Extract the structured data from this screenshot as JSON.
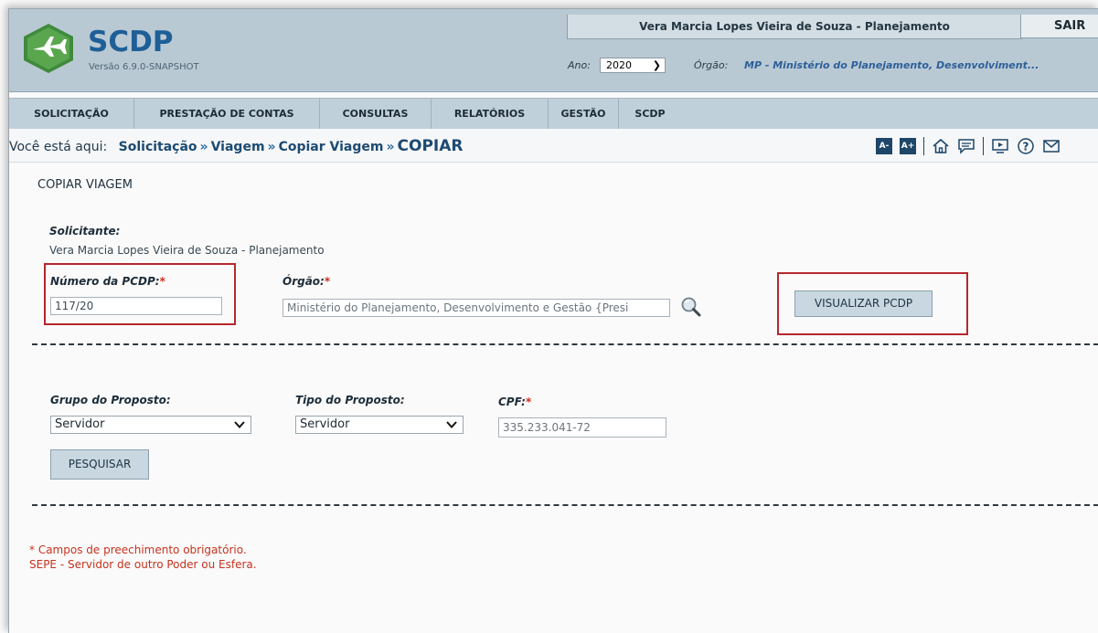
{
  "header": {
    "app_name": "SCDP",
    "version": "Versão 6.9.0-SNAPSHOT",
    "user": "Vera Marcia Lopes Vieira de Souza - Planejamento",
    "logout_label": "SAIR",
    "ano_label": "Ano:",
    "ano_value": "2020",
    "orgao_label": "Órgão:",
    "orgao_value": "MP - Ministério do Planejamento, Desenvolviment..."
  },
  "nav": {
    "items": [
      {
        "label": "SOLICITAÇÃO"
      },
      {
        "label": "PRESTAÇÃO DE CONTAS"
      },
      {
        "label": "CONSULTAS"
      },
      {
        "label": "RELATÓRIOS"
      },
      {
        "label": "GESTÃO"
      },
      {
        "label": "SCDP"
      }
    ]
  },
  "breadcrumb": {
    "prefix": "Você está aqui:",
    "items": [
      "Solicitação",
      "Viagem",
      "Copiar Viagem"
    ],
    "current": "COPIAR",
    "separator": "»"
  },
  "toolbar": {
    "font_decrease": "A-",
    "font_increase": "A+",
    "icons": [
      "home-icon",
      "chat-icon",
      "video-icon",
      "help-icon",
      "mail-icon"
    ]
  },
  "form": {
    "title": "COPIAR VIAGEM",
    "solicitante_label": "Solicitante:",
    "solicitante_value": "Vera Marcia Lopes Vieira de Souza - Planejamento",
    "numero_pcdp_label": "Número da PCDP:",
    "numero_pcdp_value": "117/20",
    "orgao_label": "Órgão:",
    "orgao_value": "Ministério do Planejamento, Desenvolvimento e Gestão {Presi",
    "visualizar_label": "VISUALIZAR PCDP",
    "required_mark": "*",
    "grupo_label": "Grupo do Proposto:",
    "grupo_value": "Servidor",
    "tipo_label": "Tipo do Proposto:",
    "tipo_value": "Servidor",
    "cpf_label": "CPF:",
    "cpf_value": "335.233.041-72",
    "pesquisar_label": "PESQUISAR"
  },
  "notes": {
    "required": "* Campos de preechimento obrigatório.",
    "sepe": "SEPE - Servidor de outro Poder ou Esfera."
  },
  "colors": {
    "header_bg": "#b9c9d4",
    "brand_blue": "#1f5f97",
    "logo_green": "#3f8a3c",
    "highlight_red": "#b5272d",
    "note_red": "#c6331e"
  }
}
